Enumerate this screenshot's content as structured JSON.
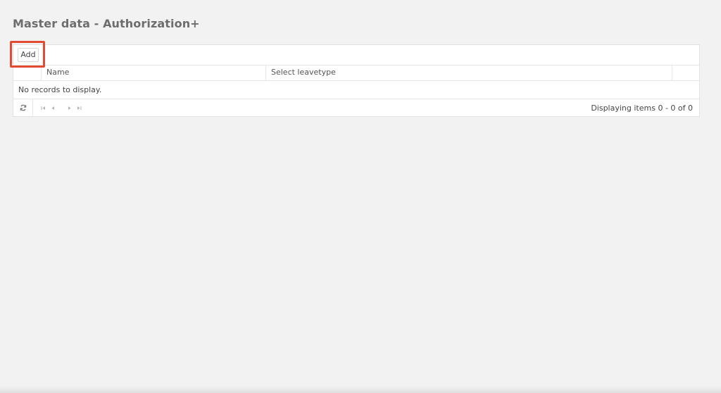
{
  "page": {
    "title": "Master data - Authorization+"
  },
  "toolbar": {
    "add_label": "Add"
  },
  "grid": {
    "columns": [
      "",
      "Name",
      "Select leavetype",
      ""
    ],
    "empty_message": "No records to display.",
    "rows": []
  },
  "pager": {
    "info": "Displaying items 0 - 0 of 0",
    "icons": [
      "refresh-icon",
      "first-page-icon",
      "prev-page-icon",
      "next-page-icon",
      "last-page-icon"
    ]
  },
  "colors": {
    "background": "#f2f2f2",
    "panel": "#ffffff",
    "border": "#e2e2e2",
    "title": "#6d6d6d",
    "highlight": "#e24a32"
  }
}
